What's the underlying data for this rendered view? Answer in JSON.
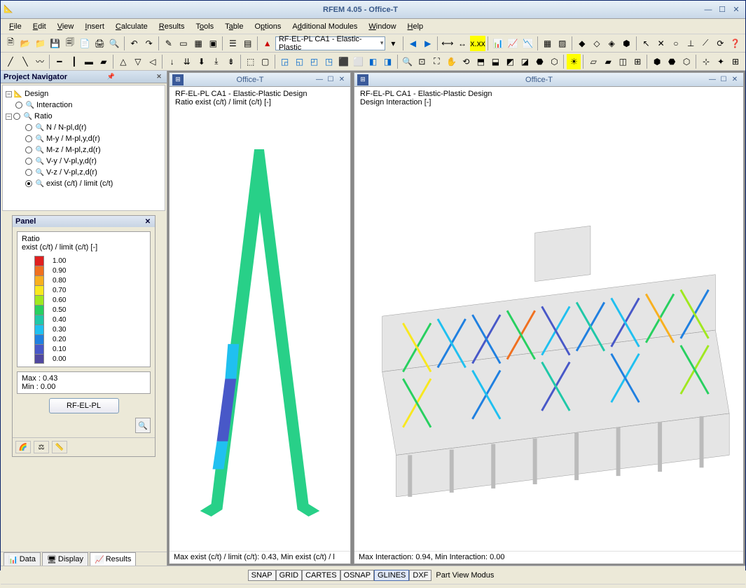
{
  "app": {
    "title": "RFEM 4.05 - Office-T"
  },
  "menu": [
    "File",
    "Edit",
    "View",
    "Insert",
    "Calculate",
    "Results",
    "Tools",
    "Table",
    "Options",
    "Additional Modules",
    "Window",
    "Help"
  ],
  "toolbar_combo": "RF-EL-PL CA1 - Elastic-Plastic",
  "navigator": {
    "title": "Project Navigator",
    "root": "Design",
    "root2": "Interaction",
    "ratio_node": "Ratio",
    "items": [
      {
        "label": "N / N-pl,d(r)",
        "sel": false
      },
      {
        "label": "M-y / M-pl,y,d(r)",
        "sel": false
      },
      {
        "label": "M-z / M-pl,z,d(r)",
        "sel": false
      },
      {
        "label": "V-y / V-pl,y,d(r)",
        "sel": false
      },
      {
        "label": "V-z / V-pl,z,d(r)",
        "sel": false
      },
      {
        "label": "exist (c/t) / limit (c/t)",
        "sel": true
      }
    ],
    "tabs": [
      {
        "label": "Data",
        "active": false
      },
      {
        "label": "Display",
        "active": false
      },
      {
        "label": "Results",
        "active": true
      }
    ]
  },
  "panel": {
    "title": "Panel",
    "ratio_title": "Ratio",
    "ratio_sub": "exist (c/t) / limit (c/t) [-]",
    "legend": [
      {
        "val": "1.00",
        "color": "#e02020"
      },
      {
        "val": "0.90",
        "color": "#f07020"
      },
      {
        "val": "0.80",
        "color": "#f8b020"
      },
      {
        "val": "0.70",
        "color": "#f8e820"
      },
      {
        "val": "0.60",
        "color": "#a0e820"
      },
      {
        "val": "0.50",
        "color": "#28d060"
      },
      {
        "val": "0.40",
        "color": "#20c8a8"
      },
      {
        "val": "0.30",
        "color": "#20c0f0"
      },
      {
        "val": "0.20",
        "color": "#2080e0"
      },
      {
        "val": "0.10",
        "color": "#4858c8"
      },
      {
        "val": "0.00",
        "color": "#5048a0"
      }
    ],
    "max_label": "Max  :",
    "max_val": "0.43",
    "min_label": "Min   :",
    "min_val": "0.00",
    "button": "RF-EL-PL"
  },
  "view1": {
    "title": "Office-T",
    "line1": "RF-EL-PL CA1 - Elastic-Plastic Design",
    "line2": "Ratio exist (c/t) / limit (c/t) [-]",
    "status": "Max exist (c/t) / limit (c/t): 0.43, Min exist (c/t) / l"
  },
  "view2": {
    "title": "Office-T",
    "line1": "RF-EL-PL CA1 - Elastic-Plastic Design",
    "line2": "Design Interaction [-]",
    "status": "Max Interaction: 0.94, Min Interaction: 0.00"
  },
  "statusbar": {
    "buttons": [
      "SNAP",
      "GRID",
      "CARTES",
      "OSNAP",
      "GLINES",
      "DXF"
    ],
    "mode": "Part View Modus"
  }
}
